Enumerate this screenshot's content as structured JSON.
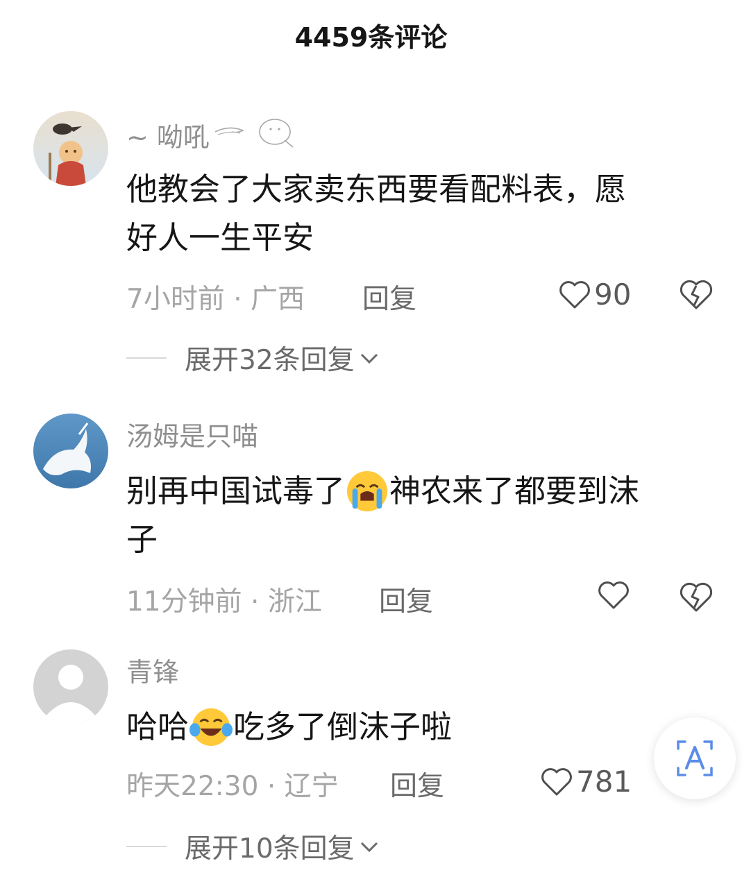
{
  "header": {
    "title": "4459条评论"
  },
  "comments": [
    {
      "username": "~ 呦吼",
      "content_parts": [
        "他教会了大家卖东西要看配料表，愿",
        "好人一生平安"
      ],
      "time": "7小时前",
      "location": "广西",
      "reply_label": "回复",
      "likes": "90",
      "expand_label": "展开32条回复"
    },
    {
      "username": "汤姆是只喵",
      "content_before": "别再中国试毒了",
      "emoji": "loudly-crying-face",
      "content_after": "神农来了都要到沫",
      "content_line2": "子",
      "time": "11分钟前",
      "location": "浙江",
      "reply_label": "回复"
    },
    {
      "username": "青锋",
      "content_before": "哈哈",
      "emoji": "face-with-tears-of-joy",
      "content_after": "吃多了倒沫子啦",
      "time": "昨天22:30",
      "location": "辽宁",
      "reply_label": "回复",
      "likes": "781",
      "expand_label": "展开10条回复"
    }
  ],
  "colors": {
    "secondary_text": "#a5a5a5",
    "username_text": "#8f8f8f",
    "reply_text": "#6a6a6a",
    "translate_accent": "#5b8de8"
  }
}
